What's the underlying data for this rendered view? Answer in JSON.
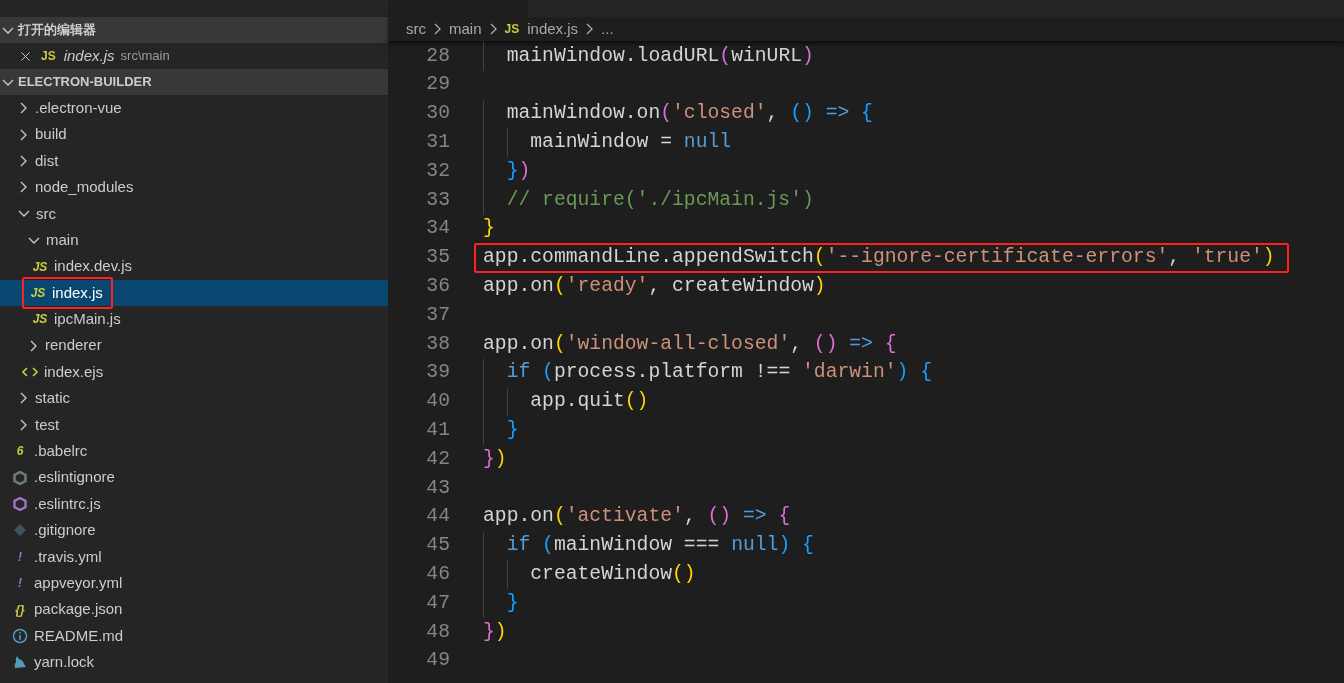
{
  "sidebar": {
    "open_editors": {
      "title": "打开的编辑器",
      "expanded": true,
      "items": [
        {
          "glyph": "JS",
          "name": "index.js",
          "path": "src\\main"
        }
      ]
    },
    "workspace": {
      "title": "ELECTRON-BUILDER",
      "expanded": true,
      "items": [
        {
          "kind": "folder",
          "name": ".electron-vue",
          "expanded": false
        },
        {
          "kind": "folder",
          "name": "build",
          "expanded": false
        },
        {
          "kind": "folder",
          "name": "dist",
          "expanded": false
        },
        {
          "kind": "folder",
          "name": "node_modules",
          "expanded": false
        },
        {
          "kind": "folder",
          "name": "src",
          "expanded": true,
          "children": [
            {
              "kind": "folder",
              "name": "main",
              "expanded": true,
              "children": [
                {
                  "kind": "file",
                  "glyph": "JS",
                  "color": "#cbcb41",
                  "name": "index.dev.js",
                  "selected": false,
                  "highlighted": false
                },
                {
                  "kind": "file",
                  "glyph": "JS",
                  "color": "#cbcb41",
                  "name": "index.js",
                  "selected": true,
                  "highlighted": true
                },
                {
                  "kind": "file",
                  "glyph": "JS",
                  "color": "#cbcb41",
                  "name": "ipcMain.js",
                  "selected": false,
                  "highlighted": false
                }
              ]
            },
            {
              "kind": "folder",
              "name": "renderer",
              "expanded": false
            },
            {
              "kind": "markup",
              "name": "index.ejs"
            }
          ]
        },
        {
          "kind": "folder",
          "name": "static",
          "expanded": false
        },
        {
          "kind": "folder",
          "name": "test",
          "expanded": false
        },
        {
          "kind": "file",
          "glyph": "6",
          "color": "#cbcb41",
          "name": ".babelrc",
          "selected": false,
          "highlighted": false
        },
        {
          "kind": "ring",
          "color": "#6d8086",
          "name": ".eslintignore"
        },
        {
          "kind": "ring",
          "color": "#a074c4",
          "name": ".eslintrc.js"
        },
        {
          "kind": "diamond",
          "color": "#41535b",
          "name": ".gitignore"
        },
        {
          "kind": "file",
          "glyph": "!",
          "color": "#a074c4",
          "name": ".travis.yml",
          "selected": false,
          "highlighted": false
        },
        {
          "kind": "file",
          "glyph": "!",
          "color": "#a074c4",
          "name": "appveyor.yml",
          "selected": false,
          "highlighted": false
        },
        {
          "kind": "file",
          "glyph": "{}",
          "color": "#cbcb41",
          "name": "package.json",
          "selected": false,
          "highlighted": false
        },
        {
          "kind": "info",
          "color": "#519aba",
          "name": "README.md"
        },
        {
          "kind": "yarn",
          "color": "#519aba",
          "name": "yarn.lock"
        }
      ]
    }
  },
  "editor": {
    "breadcrumbs": [
      {
        "text": "src"
      },
      {
        "text": "main"
      },
      {
        "text": "index.js",
        "glyph": "JS"
      },
      {
        "text": "..."
      }
    ],
    "lines": [
      {
        "number": "28",
        "highlighted": false,
        "tokens": [
          {
            "kind": "plain",
            "text": "  mainWindow.loadURL"
          },
          {
            "kind": "b2",
            "text": "("
          },
          {
            "kind": "plain",
            "text": "winURL"
          },
          {
            "kind": "b2",
            "text": ")"
          }
        ]
      },
      {
        "number": "29",
        "highlighted": false
      },
      {
        "number": "30",
        "highlighted": false,
        "tokens": [
          {
            "kind": "plain",
            "text": "  mainWindow.on"
          },
          {
            "kind": "b2",
            "text": "("
          },
          {
            "kind": "str",
            "text": "'closed'"
          },
          {
            "kind": "plain",
            "text": ", "
          },
          {
            "kind": "b3",
            "text": "() "
          },
          {
            "kind": "kw",
            "text": "=> "
          },
          {
            "kind": "b3",
            "text": "{"
          }
        ]
      },
      {
        "number": "31",
        "highlighted": false,
        "tokens": [
          {
            "kind": "plain",
            "text": "    mainWindow = "
          },
          {
            "kind": "kw",
            "text": "null"
          }
        ]
      },
      {
        "number": "32",
        "highlighted": false,
        "tokens": [
          {
            "kind": "b3",
            "text": "  }"
          },
          {
            "kind": "b2",
            "text": ")"
          }
        ]
      },
      {
        "number": "33",
        "highlighted": false,
        "tokens": [
          {
            "kind": "comment",
            "text": "  // require('./ipcMain.js')"
          }
        ]
      },
      {
        "number": "34",
        "highlighted": false,
        "tokens": [
          {
            "kind": "b1",
            "text": "}"
          }
        ]
      },
      {
        "number": "35",
        "highlighted": true,
        "tokens": [
          {
            "kind": "plain",
            "text": "app.commandLine.appendSwitch"
          },
          {
            "kind": "b1",
            "text": "("
          },
          {
            "kind": "str",
            "text": "'--ignore-certificate-errors'"
          },
          {
            "kind": "plain",
            "text": ", "
          },
          {
            "kind": "str",
            "text": "'true'"
          },
          {
            "kind": "b1",
            "text": ")"
          }
        ]
      },
      {
        "number": "36",
        "highlighted": false,
        "tokens": [
          {
            "kind": "plain",
            "text": "app.on"
          },
          {
            "kind": "b1",
            "text": "("
          },
          {
            "kind": "str",
            "text": "'ready'"
          },
          {
            "kind": "plain",
            "text": ", createWindow"
          },
          {
            "kind": "b1",
            "text": ")"
          }
        ]
      },
      {
        "number": "37",
        "highlighted": false
      },
      {
        "number": "38",
        "highlighted": false,
        "tokens": [
          {
            "kind": "plain",
            "text": "app.on"
          },
          {
            "kind": "b1",
            "text": "("
          },
          {
            "kind": "str",
            "text": "'window-all-closed'"
          },
          {
            "kind": "plain",
            "text": ", "
          },
          {
            "kind": "b2",
            "text": "() "
          },
          {
            "kind": "kw",
            "text": "=> "
          },
          {
            "kind": "b2",
            "text": "{"
          }
        ]
      },
      {
        "number": "39",
        "highlighted": false,
        "tokens": [
          {
            "kind": "kw",
            "text": "  if "
          },
          {
            "kind": "b3",
            "text": "("
          },
          {
            "kind": "plain",
            "text": "process.platform !== "
          },
          {
            "kind": "str",
            "text": "'darwin'"
          },
          {
            "kind": "b3",
            "text": ") {"
          }
        ]
      },
      {
        "number": "40",
        "highlighted": false,
        "tokens": [
          {
            "kind": "plain",
            "text": "    app.quit"
          },
          {
            "kind": "b1",
            "text": "()"
          }
        ]
      },
      {
        "number": "41",
        "highlighted": false,
        "tokens": [
          {
            "kind": "b3",
            "text": "  }"
          }
        ]
      },
      {
        "number": "42",
        "highlighted": false,
        "tokens": [
          {
            "kind": "b2",
            "text": "}"
          },
          {
            "kind": "b1",
            "text": ")"
          }
        ]
      },
      {
        "number": "43",
        "highlighted": false
      },
      {
        "number": "44",
        "highlighted": false,
        "tokens": [
          {
            "kind": "plain",
            "text": "app.on"
          },
          {
            "kind": "b1",
            "text": "("
          },
          {
            "kind": "str",
            "text": "'activate'"
          },
          {
            "kind": "plain",
            "text": ", "
          },
          {
            "kind": "b2",
            "text": "() "
          },
          {
            "kind": "kw",
            "text": "=> "
          },
          {
            "kind": "b2",
            "text": "{"
          }
        ]
      },
      {
        "number": "45",
        "highlighted": false,
        "tokens": [
          {
            "kind": "kw",
            "text": "  if "
          },
          {
            "kind": "b3",
            "text": "("
          },
          {
            "kind": "plain",
            "text": "mainWindow === "
          },
          {
            "kind": "kw",
            "text": "null"
          },
          {
            "kind": "b3",
            "text": ") {"
          }
        ]
      },
      {
        "number": "46",
        "highlighted": false,
        "tokens": [
          {
            "kind": "plain",
            "text": "    createWindow"
          },
          {
            "kind": "b1",
            "text": "()"
          }
        ]
      },
      {
        "number": "47",
        "highlighted": false,
        "tokens": [
          {
            "kind": "b3",
            "text": "  }"
          }
        ]
      },
      {
        "number": "48",
        "highlighted": false,
        "tokens": [
          {
            "kind": "b2",
            "text": "}"
          },
          {
            "kind": "b1",
            "text": ")"
          }
        ]
      },
      {
        "number": "49",
        "highlighted": false
      }
    ]
  }
}
